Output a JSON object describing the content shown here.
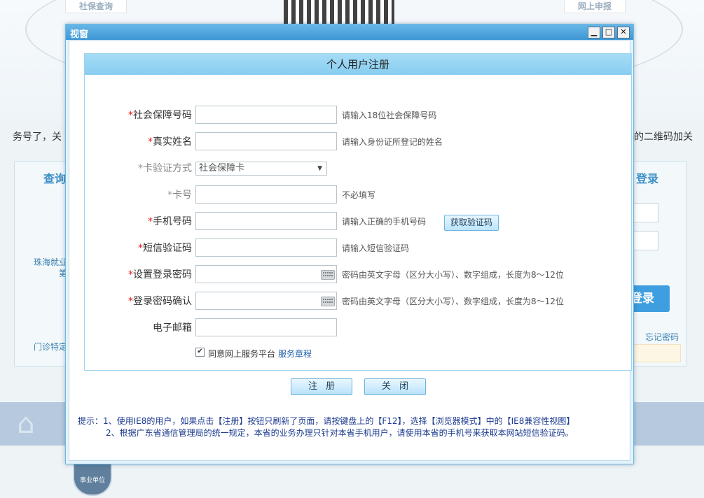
{
  "background": {
    "top_links": [
      "社保查询",
      "网上申报"
    ],
    "side_left_text": "务号了，关",
    "side_right_text": "的二维码加关",
    "panel_left_title": "查询",
    "panel_right_title": "登录",
    "left_items": [
      "珠海就业",
      "第",
      "门诊特定"
    ],
    "login_button": "登录",
    "forget_password": "忘记密码",
    "badge_text": "事业单位"
  },
  "window": {
    "title": "视窗",
    "minimize_glyph": "▁",
    "maximize_glyph": "□",
    "close_glyph": "✕"
  },
  "form": {
    "heading": "个人用户注册",
    "fields": {
      "ssn": {
        "required": "*",
        "label": "社会保障号码",
        "value": "",
        "hint": "请输入18位社会保障号码"
      },
      "name": {
        "required": "*",
        "label": "真实姓名",
        "value": "",
        "hint": "请输入身份证所登记的姓名"
      },
      "card_method": {
        "required": "*",
        "label": "卡验证方式",
        "value": "社会保障卡"
      },
      "card_no": {
        "required": "*",
        "label": "卡号",
        "value": "",
        "hint": "不必填写"
      },
      "phone": {
        "required": "*",
        "label": "手机号码",
        "value": "",
        "hint": "请输入正确的手机号码",
        "code_button": "获取验证码"
      },
      "sms": {
        "required": "*",
        "label": "短信验证码",
        "value": "",
        "hint": "请输入短信验证码"
      },
      "password": {
        "required": "*",
        "label": "设置登录密码",
        "value": "",
        "hint": "密码由英文字母（区分大小写）、数字组成，长度为8～12位"
      },
      "password_confirm": {
        "required": "*",
        "label": "登录密码确认",
        "value": "",
        "hint": "密码由英文字母（区分大小写）、数字组成，长度为8～12位"
      },
      "email": {
        "label": "电子邮箱",
        "value": ""
      }
    },
    "agree_text": "同意网上服务平台",
    "agree_link": "服务章程",
    "agree_checked": "✔",
    "register_button": "注册",
    "close_button": "关闭",
    "tip_line1": "提示：1、使用IE8的用户，如果点击【注册】按钮只刷新了页面，请按键盘上的【F12】，选择【浏览器模式】中的【IE8兼容性视图】",
    "tip_line2": "2、根据广东省通信管理局的统一规定，本省的业务办理只针对本省手机用户，请使用本省的手机号来获取本网站短信验证码。"
  }
}
